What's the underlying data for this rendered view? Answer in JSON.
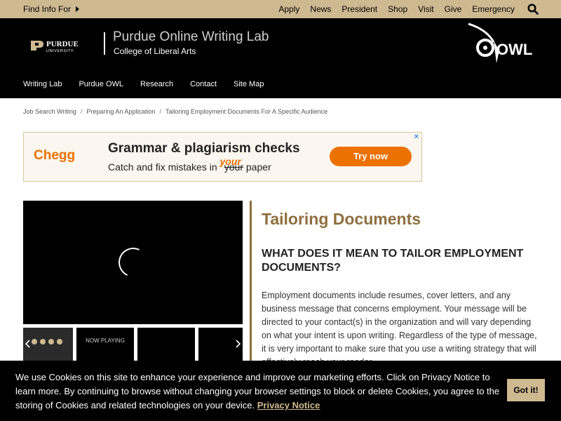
{
  "topbar": {
    "find_info": "Find Info For",
    "links": [
      "Apply",
      "News",
      "President",
      "Shop",
      "Visit",
      "Give",
      "Emergency"
    ],
    "search_icon": "search-icon"
  },
  "header": {
    "logo_text": "PURDUE",
    "logo_sub": "UNIVERSITY.",
    "title": "Purdue Online Writing Lab",
    "subtitle": "College of Liberal Arts",
    "owl_logo": "OWL"
  },
  "nav": [
    "Writing Lab",
    "Purdue OWL",
    "Research",
    "Contact",
    "Site Map"
  ],
  "breadcrumb": [
    "Job Search Writing",
    "Preparing An Application",
    "Tailoring Employment Documents For A Specific Audience"
  ],
  "ad": {
    "brand": "Chegg",
    "title": "Grammar & plagiarism checks",
    "sub_before": "Catch and fix mistakes in ",
    "sub_strike": "your",
    "sub_hand": "your",
    "sub_after": " paper",
    "button": "Try now",
    "close": "✕"
  },
  "video": {
    "now_playing": "NOW PLAYING"
  },
  "article": {
    "title": "Tailoring Documents",
    "heading": "WHAT DOES IT MEAN TO TAILOR EMPLOYMENT DOCUMENTS?",
    "paragraph": "Employment documents include resumes, cover letters, and any business message that concerns employment. Your message will be directed to your contact(s) in the organization and will vary depending on what your intent is upon writing. Regardless of the type of message, it is very important to make sure that you use a writing strategy that will effectively reach your reader."
  },
  "cookie": {
    "text": "We use Cookies on this site to enhance your experience and improve our marketing efforts. Click on Privacy Notice to learn more. By continuing to browse without changing your browser settings to block or delete Cookies, you agree to the storing of Cookies and related technologies on your device.",
    "link": "Privacy Notice",
    "button": "Got it!"
  },
  "colors": {
    "gold": "#cfb991",
    "dark_gold": "#8e6f3e",
    "black": "#000000",
    "chegg_orange": "#eb7100"
  }
}
